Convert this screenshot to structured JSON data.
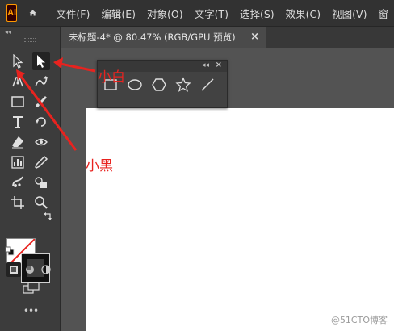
{
  "app": {
    "logo_text": "Ai",
    "brand_color": "#ff9a00"
  },
  "menu": [
    "文件(F)",
    "编辑(E)",
    "对象(O)",
    "文字(T)",
    "选择(S)",
    "效果(C)",
    "视图(V)",
    "窗"
  ],
  "document_tab": {
    "title": "未标题-4* @ 80.47% (RGB/GPU 预览)",
    "close_symbol": "×"
  },
  "toolbar": {
    "collapse_symbol": "◂◂",
    "tools": [
      "direct-selection",
      "selection",
      "pen",
      "curvature",
      "rectangle",
      "paintbrush",
      "type",
      "rotate",
      "eraser",
      "warp",
      "chart",
      "eyedropper",
      "symbol-sprayer",
      "shape-builder",
      "artboard",
      "zoom"
    ],
    "more_symbol": "•••"
  },
  "shape_panel": {
    "collapse_symbol": "◂◂",
    "close_symbol": "×",
    "tools": [
      "rectangle",
      "ellipse",
      "polygon",
      "star",
      "line"
    ]
  },
  "annotations": {
    "white_arrow": "小白",
    "black_arrow": "小黑",
    "color": "#e8231f"
  },
  "watermark": "@51CTO博客",
  "colors": {
    "menubar": "#323232",
    "toolbar": "#3c3c3c",
    "workspace": "#535353",
    "artboard": "#ffffff"
  }
}
